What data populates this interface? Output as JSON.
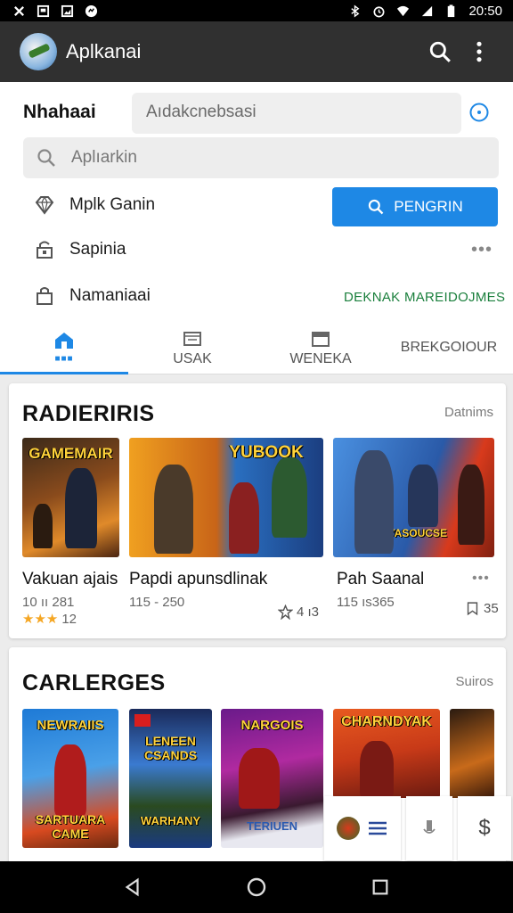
{
  "status_bar": {
    "time": "20:50",
    "left_icons": [
      "close-icon",
      "image-icon",
      "image-icon",
      "chat-icon"
    ],
    "right_icons": [
      "bluetooth-icon",
      "alarm-icon",
      "wifi-icon",
      "signal-icon",
      "battery-icon"
    ]
  },
  "app_bar": {
    "title": "Aplkanai",
    "actions": [
      "search-icon",
      "more-vert-icon"
    ]
  },
  "filter": {
    "label": "Nhahaai",
    "field_value": "Aıdakcnebsasi"
  },
  "search": {
    "placeholder": "Aplıarkin"
  },
  "options": {
    "item1_label": "Mplk Ganin",
    "item2_label": "Sapinia",
    "item3_label": "Namaniaai",
    "primary_button": "PENGRIN",
    "green_link": "DEKNAK MAREIDOJMES"
  },
  "tabs": [
    {
      "label": "",
      "active": true,
      "icon": "home-icon"
    },
    {
      "label": "USAK",
      "active": false,
      "icon": "folder-icon"
    },
    {
      "label": "WENEKA",
      "active": false,
      "icon": "calendar-icon"
    },
    {
      "label": "BREKGOIOUR",
      "active": false,
      "icon": ""
    }
  ],
  "section1": {
    "title": "RADIERIRIS",
    "link": "Datnims",
    "items": [
      {
        "art_label": "GAMEMAIR",
        "title": "Vakuan ajais",
        "sub": "10 ıı 281",
        "rating": "12"
      },
      {
        "art_label": "YUBOOK",
        "title": "Papdi apunsdlinak",
        "sub": "115 - 250",
        "count": "4 ı3"
      },
      {
        "art_label": "NYASOUCSE",
        "title": "Pah Saanal",
        "sub": "115 ıs365",
        "count": "35"
      }
    ]
  },
  "section2": {
    "title": "CARLERGES",
    "link": "Suiros",
    "items": [
      {
        "art_top": "NEWRAIIS",
        "art_bottom": "SARTUARA CAME"
      },
      {
        "art_top": "LENEEN CSANDS",
        "art_bottom": "WARHANY"
      },
      {
        "art_top": "NARGOIS",
        "art_bottom": "TERIUEN"
      },
      {
        "art_top": "CHARNDYAK",
        "art_bottom": ""
      }
    ]
  },
  "colors": {
    "accent": "#1e88e5",
    "app_bar": "#303030",
    "link_green": "#1a7f3c",
    "star": "#f5a623"
  }
}
